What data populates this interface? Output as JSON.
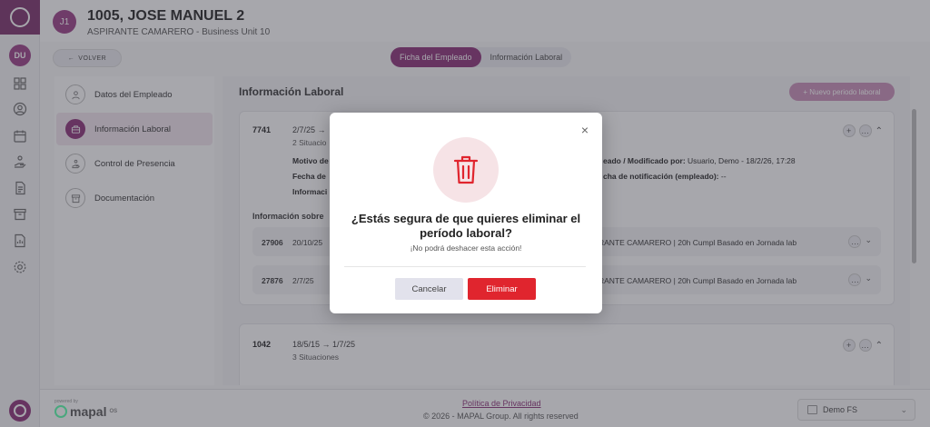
{
  "rail": {
    "user_initials": "DU",
    "icons": [
      "logo-icon",
      "dashboard-icon",
      "person-circle-icon",
      "calendar-icon",
      "hand-icon",
      "document-icon",
      "archive-icon",
      "report-icon",
      "settings-icon"
    ]
  },
  "header": {
    "avatar_initials": "J1",
    "employee_name": "1005, JOSE MANUEL 2",
    "employee_subtitle": "ASPIRANTE CAMARERO - Business Unit 10"
  },
  "toolbar": {
    "back_label": "VOLVER",
    "tabs": [
      {
        "label": "Ficha del Empleado",
        "active": true
      },
      {
        "label": "Información Laboral",
        "active": false
      }
    ]
  },
  "sidenav": {
    "items": [
      {
        "label": "Datos del Empleado",
        "active": false
      },
      {
        "label": "Información Laboral",
        "active": true
      },
      {
        "label": "Control de Presencia",
        "active": false
      },
      {
        "label": "Documentación",
        "active": false
      }
    ]
  },
  "main": {
    "title": "Información Laboral",
    "new_button_label": "+ Nuevo periodo laboral",
    "cards": [
      {
        "id": "7741",
        "dates": "2/7/25  →",
        "situations": "2 Situacio",
        "fields": {
          "motivo_label": "Motivo de",
          "fecha_label": "Fecha de",
          "info_label": "Informaci",
          "creado_label": "eado / Modificado por:",
          "creado_value": "Usuario, Demo - 18/2/26, 17:28",
          "notif_label": "cha de notificación (empleado):",
          "notif_value": "--"
        },
        "section_title": "Información sobre",
        "rows": [
          {
            "id": "27906",
            "date": "20/10/25",
            "desc": "RANTE CAMARERO  |  20h Cumpl Basado en Jornada lab"
          },
          {
            "id": "27876",
            "date": "2/7/25",
            "desc": "RANTE CAMARERO  |  20h Cumpl Basado en Jornada lab"
          }
        ]
      },
      {
        "id": "1042",
        "dates": "18/5/15  →  1/7/25",
        "situations": "3 Situaciones"
      }
    ]
  },
  "footer": {
    "powered_by": "powered by",
    "brand": "mapal",
    "brand_suffix": "OS",
    "privacy_link": "Política de Privacidad",
    "copyright": "© 2026 - MAPAL Group. All rights reserved",
    "org_selected": "Demo FS"
  },
  "modal": {
    "title": "¿Estás segura de que quieres eliminar el período laboral?",
    "subtitle": "¡No podrá deshacer esta acción!",
    "cancel_label": "Cancelar",
    "delete_label": "Eliminar",
    "close_glyph": "×",
    "accent_color": "#e0252e"
  },
  "colors": {
    "brand": "#8a2f77",
    "danger": "#e0252e"
  }
}
